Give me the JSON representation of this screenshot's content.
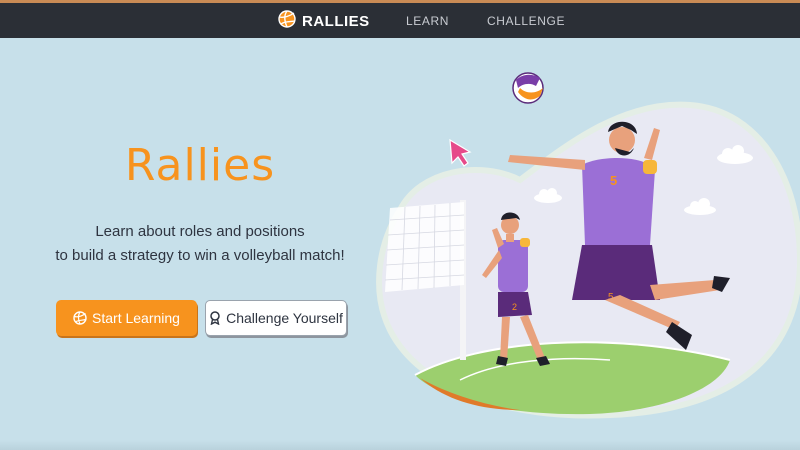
{
  "nav": {
    "brand": "RALLIES",
    "links": [
      "LEARN",
      "CHALLENGE"
    ]
  },
  "hero": {
    "title": "Rallies",
    "subtitle_line1": "Learn about roles and positions",
    "subtitle_line2": "to build a strategy to win a volleyball match!",
    "primary_button": "Start Learning",
    "secondary_button": "Challenge Yourself"
  },
  "illustration": {
    "front_player_number": "5",
    "back_player_number": "2"
  },
  "colors": {
    "accent": "#f7931e",
    "navbar": "#2b2f36",
    "background": "#c7e0ea",
    "jersey": "#9b6fd6",
    "shorts": "#5a2b7a"
  },
  "icons": {
    "brand": "volleyball-icon",
    "primary_button": "volleyball-icon",
    "secondary_button": "award-icon",
    "cursor": "pointer-cursor-icon"
  }
}
